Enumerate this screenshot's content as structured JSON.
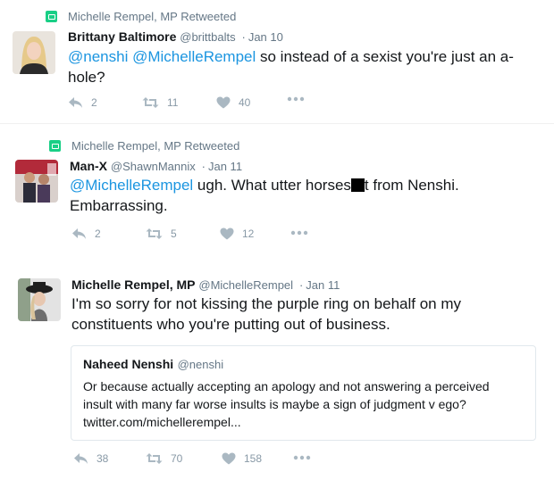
{
  "tweets": [
    {
      "retweet_label": "Michelle Rempel, MP Retweeted",
      "name": "Brittany Baltimore",
      "handle": "@brittbalts",
      "time": "Jan 10",
      "text_mentions": "@nenshi @MichelleRempel",
      "text_rest": " so instead of a sexist you're just an a-hole?",
      "reply_count": "2",
      "retweet_count": "11",
      "like_count": "40"
    },
    {
      "retweet_label": "Michelle Rempel, MP Retweeted",
      "name": "Man-X",
      "handle": "@ShawnMannix",
      "time": "Jan 11",
      "text_mentions": "@MichelleRempel",
      "text_before_redact": " ugh. What utter horses",
      "text_after_redact": "t from Nenshi. Embarrassing.",
      "reply_count": "2",
      "retweet_count": "5",
      "like_count": "12"
    },
    {
      "name": "Michelle Rempel, MP",
      "handle": "@MichelleRempel",
      "time": "Jan 11",
      "text": "I'm so sorry for not kissing the purple ring on behalf on my constituents who you're putting out of business.",
      "quote": {
        "name": "Naheed Nenshi",
        "handle": "@nenshi",
        "text": "Or because actually accepting an apology and not answering a perceived insult with many far worse insults is maybe a sign of judgment v ego? twitter.com/michellerempel..."
      },
      "reply_count": "38",
      "retweet_count": "70",
      "like_count": "158"
    }
  ],
  "icons": {
    "retweet_badge": "retweet-badge-icon",
    "reply": "reply-icon",
    "retweet": "retweet-icon",
    "like": "heart-icon",
    "more": "more-icon"
  },
  "colors": {
    "link": "#1b95e0",
    "muted": "#657786",
    "action": "#8899a6",
    "retweet_green": "#19cf86"
  }
}
